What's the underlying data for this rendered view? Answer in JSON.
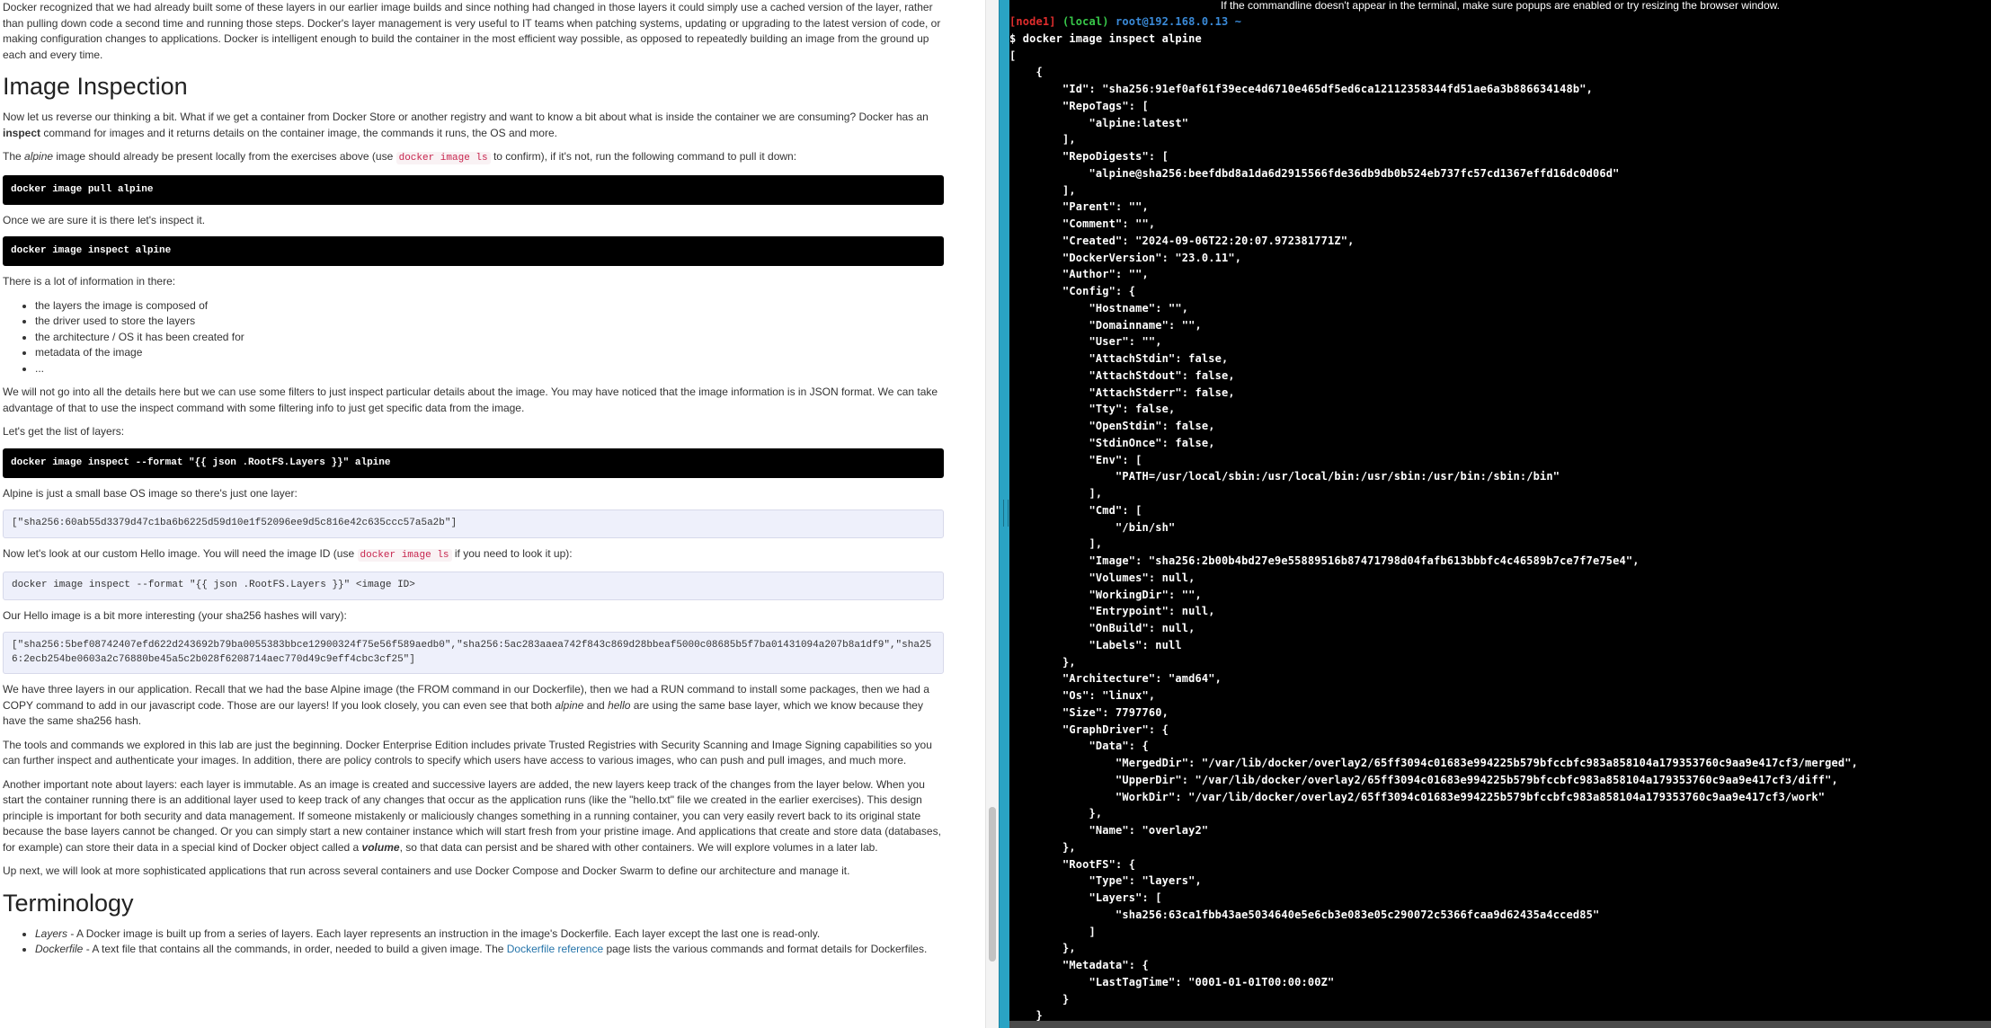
{
  "left": {
    "intro": "Docker recognized that we had already built some of these layers in our earlier image builds and since nothing had changed in those layers it could simply use a cached version of the layer, rather than pulling down code a second time and running those steps. Docker's layer management is very useful to IT teams when patching systems, updating or upgrading to the latest version of code, or making configuration changes to applications. Docker is intelligent enough to build the container in the most efficient way possible, as opposed to repeatedly building an image from the ground up each and every time.",
    "h_inspection": "Image Inspection",
    "p1": {
      "a": "Now let us reverse our thinking a bit. What if we get a container from Docker Store or another registry and want to know a bit about what is inside the container we are consuming? Docker has an ",
      "b": "inspect",
      "c": " command for images and it returns details on the container image, the commands it runs, the OS and more."
    },
    "p2": {
      "a": "The ",
      "b": "alpine",
      "c": " image should already be present locally from the exercises above (use ",
      "code": "docker image ls",
      "d": " to confirm), if it's not, run the following command to pull it down:"
    },
    "code_pull": "docker image pull alpine",
    "p3": "Once we are sure it is there let's inspect it.",
    "code_inspect": "docker image inspect alpine",
    "p4": "There is a lot of information in there:",
    "list1": [
      "the layers the image is composed of",
      "the driver used to store the layers",
      "the architecture / OS it has been created for",
      "metadata of the image",
      "..."
    ],
    "p5": "We will not go into all the details here but we can use some filters to just inspect particular details about the image. You may have noticed that the image information is in JSON format. We can take advantage of that to use the inspect command with some filtering info to just get specific data from the image.",
    "p6": "Let's get the list of layers:",
    "code_layers": "docker image inspect --format \"{{ json .RootFS.Layers }}\" alpine",
    "p7": "Alpine is just a small base OS image so there's just one layer:",
    "out1": "[\"sha256:60ab55d3379d47c1ba6b6225d59d10e1f52096ee9d5c816e42c635ccc57a5a2b\"]",
    "p8": {
      "a": "Now let's look at our custom Hello image. You will need the image ID (use ",
      "code": "docker image ls",
      "b": " if you need to look it up):"
    },
    "code_hello": "docker image inspect --format \"{{ json .RootFS.Layers }}\" <image ID>",
    "p9": "Our Hello image is a bit more interesting (your sha256 hashes will vary):",
    "out2": "[\"sha256:5bef08742407efd622d243692b79ba0055383bbce12900324f75e56f589aedb0\",\"sha256:5ac283aaea742f843c869d28bbeaf5000c08685b5f7ba01431094a207b8a1df9\",\"sha256:2ecb254be0603a2c76880be45a5c2b028f6208714aec770d49c9eff4cbc3cf25\"]",
    "p10": {
      "a": "We have three layers in our application. Recall that we had the base Alpine image (the FROM command in our Dockerfile), then we had a RUN command to install some packages, then we had a COPY command to add in our javascript code. Those are our layers! If you look closely, you can even see that both ",
      "b": "alpine",
      "c": " and ",
      "d": "hello",
      "e": " are using the same base layer, which we know because they have the same sha256 hash."
    },
    "p11": "The tools and commands we explored in this lab are just the beginning. Docker Enterprise Edition includes private Trusted Registries with Security Scanning and Image Signing capabilities so you can further inspect and authenticate your images. In addition, there are policy controls to specify which users have access to various images, who can push and pull images, and much more.",
    "p12": {
      "a": "Another important note about layers: each layer is immutable. As an image is created and successive layers are added, the new layers keep track of the changes from the layer below. When you start the container running there is an additional layer used to keep track of any changes that occur as the application runs (like the \"hello.txt\" file we created in the earlier exercises). This design principle is important for both security and data management. If someone mistakenly or maliciously changes something in a running container, you can very easily revert back to its original state because the base layers cannot be changed. Or you can simply start a new container instance which will start fresh from your pristine image. And applications that create and store data (databases, for example) can store their data in a special kind of Docker object called a ",
      "b": "volume",
      "c": ", so that data can persist and be shared with other containers. We will explore volumes in a later lab."
    },
    "p13": "Up next, we will look at more sophisticated applications that run across several containers and use Docker Compose and Docker Swarm to define our architecture and manage it.",
    "h_terminology": "Terminology",
    "term1": {
      "name": "Layers",
      "text": " - A Docker image is built up from a series of layers. Each layer represents an instruction in the image's Dockerfile. Each layer except the last one is read-only."
    },
    "term2": {
      "name": "Dockerfile",
      "text": " - A text file that contains all the commands, in order, needed to build a given image. The ",
      "link": "Dockerfile reference",
      "text2": " page lists the various commands and format details for Dockerfiles."
    }
  },
  "terminal": {
    "banner": "If the commandline doesn't appear in the terminal, make sure popups are enabled or try resizing the browser window.",
    "prompt": {
      "node": "[node1]",
      "local": "(local)",
      "host": "root@192.168.0.13 ~"
    },
    "command": "$ docker image inspect alpine",
    "output": [
      "[",
      "    {",
      "        \"Id\": \"sha256:91ef0af61f39ece4d6710e465df5ed6ca12112358344fd51ae6a3b886634148b\",",
      "        \"RepoTags\": [",
      "            \"alpine:latest\"",
      "        ],",
      "        \"RepoDigests\": [",
      "            \"alpine@sha256:beefdbd8a1da6d2915566fde36db9db0b524eb737fc57cd1367effd16dc0d06d\"",
      "        ],",
      "        \"Parent\": \"\",",
      "        \"Comment\": \"\",",
      "        \"Created\": \"2024-09-06T22:20:07.972381771Z\",",
      "        \"DockerVersion\": \"23.0.11\",",
      "        \"Author\": \"\",",
      "        \"Config\": {",
      "            \"Hostname\": \"\",",
      "            \"Domainname\": \"\",",
      "            \"User\": \"\",",
      "            \"AttachStdin\": false,",
      "            \"AttachStdout\": false,",
      "            \"AttachStderr\": false,",
      "            \"Tty\": false,",
      "            \"OpenStdin\": false,",
      "            \"StdinOnce\": false,",
      "            \"Env\": [",
      "                \"PATH=/usr/local/sbin:/usr/local/bin:/usr/sbin:/usr/bin:/sbin:/bin\"",
      "            ],",
      "            \"Cmd\": [",
      "                \"/bin/sh\"",
      "            ],",
      "            \"Image\": \"sha256:2b00b4bd27e9e55889516b87471798d04fafb613bbbfc4c46589b7ce7f7e75e4\",",
      "            \"Volumes\": null,",
      "            \"WorkingDir\": \"\",",
      "            \"Entrypoint\": null,",
      "            \"OnBuild\": null,",
      "            \"Labels\": null",
      "        },",
      "        \"Architecture\": \"amd64\",",
      "        \"Os\": \"linux\",",
      "        \"Size\": 7797760,",
      "        \"GraphDriver\": {",
      "            \"Data\": {",
      "                \"MergedDir\": \"/var/lib/docker/overlay2/65ff3094c01683e994225b579bfccbfc983a858104a179353760c9aa9e417cf3/merged\",",
      "                \"UpperDir\": \"/var/lib/docker/overlay2/65ff3094c01683e994225b579bfccbfc983a858104a179353760c9aa9e417cf3/diff\",",
      "                \"WorkDir\": \"/var/lib/docker/overlay2/65ff3094c01683e994225b579bfccbfc983a858104a179353760c9aa9e417cf3/work\"",
      "            },",
      "            \"Name\": \"overlay2\"",
      "        },",
      "        \"RootFS\": {",
      "            \"Type\": \"layers\",",
      "            \"Layers\": [",
      "                \"sha256:63ca1fbb43ae5034640e5e6cb3e083e05c290072c5366fcaa9d62435a4cced85\"",
      "            ]",
      "        },",
      "        \"Metadata\": {",
      "            \"LastTagTime\": \"0001-01-01T00:00:00Z\"",
      "        }",
      "    }"
    ]
  }
}
